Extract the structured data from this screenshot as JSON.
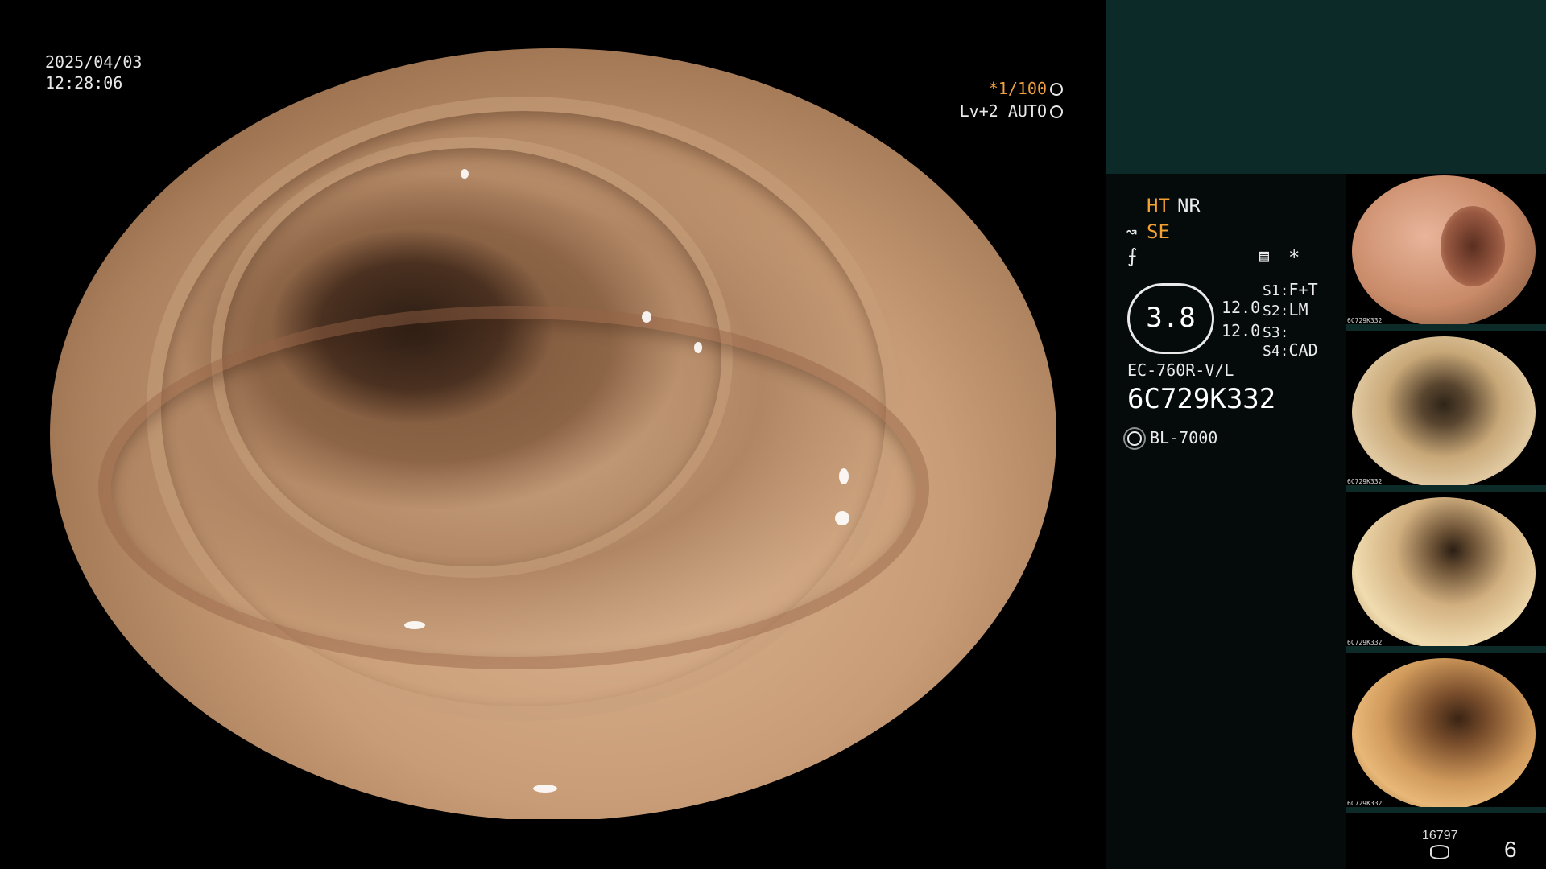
{
  "overlay": {
    "date": "2025/04/03",
    "time": "12:28:06",
    "shutter": "*1/100",
    "level": "Lv+2 AUTO"
  },
  "panel": {
    "ht": "HT",
    "nr": "NR",
    "se": "SE",
    "gauge_value": "3.8",
    "gauge_side_top": "12.0",
    "gauge_side_bottom": "12.0",
    "slots": [
      {
        "key": "S1:",
        "value": "F+T"
      },
      {
        "key": "S2:",
        "value": "LM"
      },
      {
        "key": "S3:",
        "value": ""
      },
      {
        "key": "S4:",
        "value": "CAD"
      }
    ],
    "scope_model": "EC-760R-V/L",
    "serial": "6C729K332",
    "light_source": "BL-7000",
    "asterisk": "*"
  },
  "thumbnails": [
    {
      "label": "6C729K332"
    },
    {
      "label": "6C729K332"
    },
    {
      "label": "6C729K332"
    },
    {
      "label": "6C729K332"
    }
  ],
  "footer": {
    "image_count": "16797",
    "page_number": "6"
  }
}
